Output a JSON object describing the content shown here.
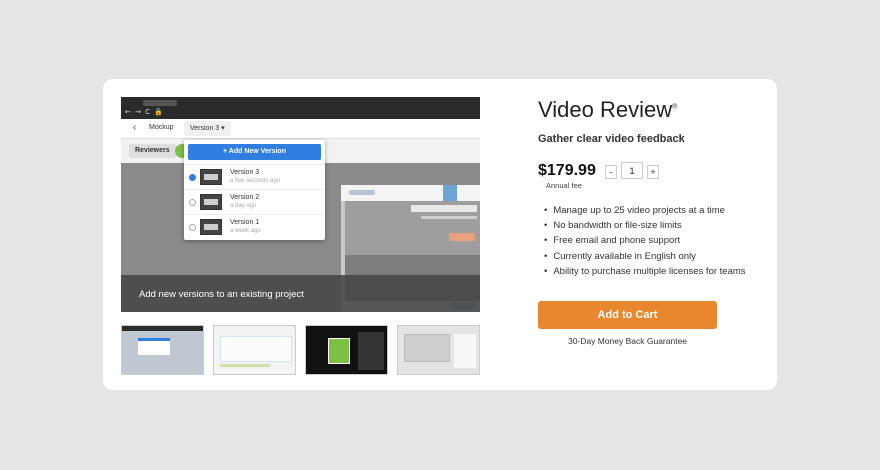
{
  "product": {
    "title": "Video Review",
    "trademark": "®",
    "subtitle": "Gather clear video feedback",
    "price": "$179.99",
    "price_note": "Annual fee",
    "quantity": "1",
    "qty_minus": "-",
    "qty_plus": "+",
    "features": [
      "Manage up to 25 video projects at a time",
      "No bandwidth or file-size limits",
      "Free email and phone support",
      "Currently available in English only",
      "Ability to purchase multiple licenses for teams"
    ],
    "cta_label": "Add to Cart",
    "guarantee": "30-Day Money Back Guarantee"
  },
  "screenshot": {
    "nav_glyphs": "← → C 🔒",
    "back": "‹",
    "breadcrumb": "Mockup",
    "version_selector": "Version 3 ▾",
    "reviewers_label": "Reviewers",
    "add_version_label": "+ Add New Version",
    "versions": [
      {
        "name": "Version 3",
        "time": "a few seconds ago"
      },
      {
        "name": "Version 2",
        "time": "a day ago"
      },
      {
        "name": "Version 1",
        "time": "a week ago"
      }
    ],
    "caption": "Add new versions to an existing project"
  },
  "colors": {
    "accent_orange": "#e8872d",
    "accent_blue": "#2f7ee0",
    "card_bg": "#ffffff",
    "page_bg": "#e6e6e6"
  }
}
